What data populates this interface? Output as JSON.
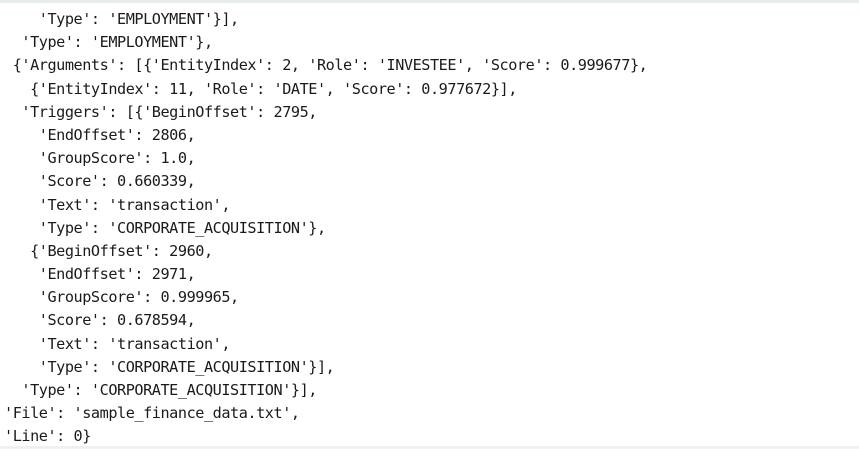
{
  "output": {
    "lines": [
      "    'Type': 'EMPLOYMENT'}],",
      "  'Type': 'EMPLOYMENT'},",
      " {'Arguments': [{'EntityIndex': 2, 'Role': 'INVESTEE', 'Score': 0.999677},",
      "   {'EntityIndex': 11, 'Role': 'DATE', 'Score': 0.977672}],",
      "  'Triggers': [{'BeginOffset': 2795,",
      "    'EndOffset': 2806,",
      "    'GroupScore': 1.0,",
      "    'Score': 0.660339,",
      "    'Text': 'transaction',",
      "    'Type': 'CORPORATE_ACQUISITION'},",
      "   {'BeginOffset': 2960,",
      "    'EndOffset': 2971,",
      "    'GroupScore': 0.999965,",
      "    'Score': 0.678594,",
      "    'Text': 'transaction',",
      "    'Type': 'CORPORATE_ACQUISITION'}],",
      "  'Type': 'CORPORATE_ACQUISITION'}],",
      "'File': 'sample_finance_data.txt',",
      "'Line': 0}"
    ]
  }
}
